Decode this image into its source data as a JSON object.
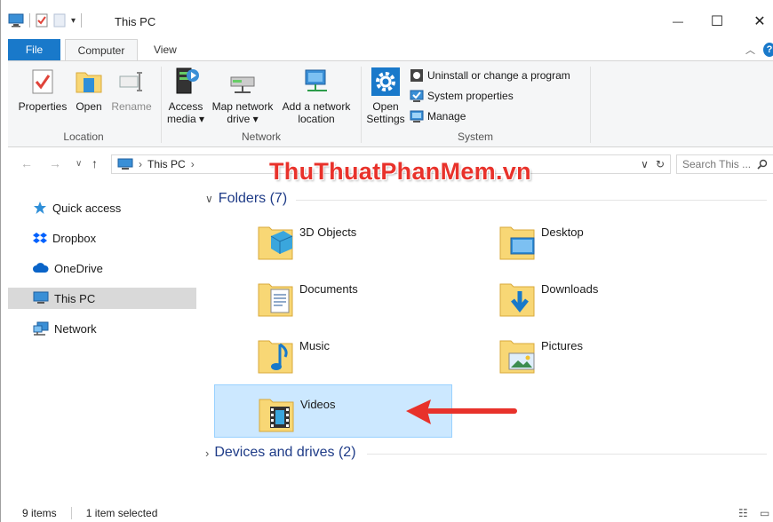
{
  "window": {
    "title": "This PC",
    "minimize": "—",
    "maximize": "☐",
    "close": "✕"
  },
  "ribbon_tabs": [
    {
      "label": "File"
    },
    {
      "label": "Computer"
    },
    {
      "label": "View"
    }
  ],
  "ribbon": {
    "location": {
      "label": "Location",
      "properties": "Properties",
      "open": "Open",
      "rename": "Rename"
    },
    "network": {
      "label": "Network",
      "access_media_1": "Access",
      "access_media_2": "media ▾",
      "map_drive_1": "Map network",
      "map_drive_2": "drive ▾",
      "add_location_1": "Add a network",
      "add_location_2": "location"
    },
    "system": {
      "label": "System",
      "open_settings_1": "Open",
      "open_settings_2": "Settings",
      "uninstall": "Uninstall or change a program",
      "system_properties": "System properties",
      "manage": "Manage"
    }
  },
  "address": {
    "path": "This PC",
    "search_placeholder": "Search This ..."
  },
  "sidebar": {
    "items": [
      {
        "label": "Quick access"
      },
      {
        "label": "Dropbox"
      },
      {
        "label": "OneDrive"
      },
      {
        "label": "This PC"
      },
      {
        "label": "Network"
      }
    ]
  },
  "sections": {
    "folders": "Folders (7)",
    "devices": "Devices and drives (2)"
  },
  "folders": [
    {
      "name": "3D Objects"
    },
    {
      "name": "Desktop"
    },
    {
      "name": "Documents"
    },
    {
      "name": "Downloads"
    },
    {
      "name": "Music"
    },
    {
      "name": "Pictures"
    },
    {
      "name": "Videos"
    }
  ],
  "watermark": "ThuThuatPhanMem.vn",
  "status": {
    "items": "9 items",
    "selected": "1 item selected"
  },
  "colors": {
    "accent": "#1979ca",
    "selection": "#cce8ff",
    "folder": "#f8d775",
    "arrow": "#e8322b"
  }
}
